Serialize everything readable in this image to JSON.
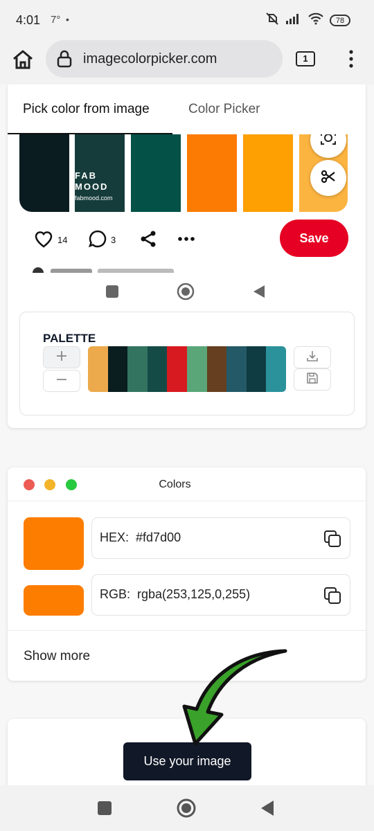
{
  "status_bar": {
    "time": "4:01",
    "temperature": "7°",
    "dot": "•",
    "battery": "78"
  },
  "browser": {
    "url": "imagecolorpicker.com",
    "tab_count": "1"
  },
  "tabs": {
    "active": "Pick color from image",
    "other": "Color Picker"
  },
  "pin": {
    "brand_line1": "FAB",
    "brand_line2": "MOOD",
    "brand_url": "fabmood.com",
    "strip_colors": [
      "#0b1c20",
      "#153c3a",
      "#045147",
      "#fc7b02",
      "#fe9f02",
      "#fcb441"
    ],
    "likes": "14",
    "comments": "3",
    "save_label": "Save"
  },
  "palette": {
    "title": "PALETTE",
    "colors": [
      "#ecaa4d",
      "#0a1d1f",
      "#327460",
      "#144b47",
      "#d71a20",
      "#5aa679",
      "#653f20",
      "#245a67",
      "#0e3c42",
      "#2b929b"
    ]
  },
  "colors_window": {
    "title": "Colors",
    "dot_colors": [
      "#ed5b55",
      "#f3b42a",
      "#27c93f"
    ],
    "selected_color": "#fd7d00",
    "hex_label": "HEX:",
    "hex_value": "#fd7d00",
    "rgb_label": "RGB:",
    "rgb_value": "rgba(253,125,0,255)",
    "show_more": "Show more"
  },
  "cta": {
    "use_image_label": "Use your image",
    "arrow_color": "#3aa12a"
  }
}
